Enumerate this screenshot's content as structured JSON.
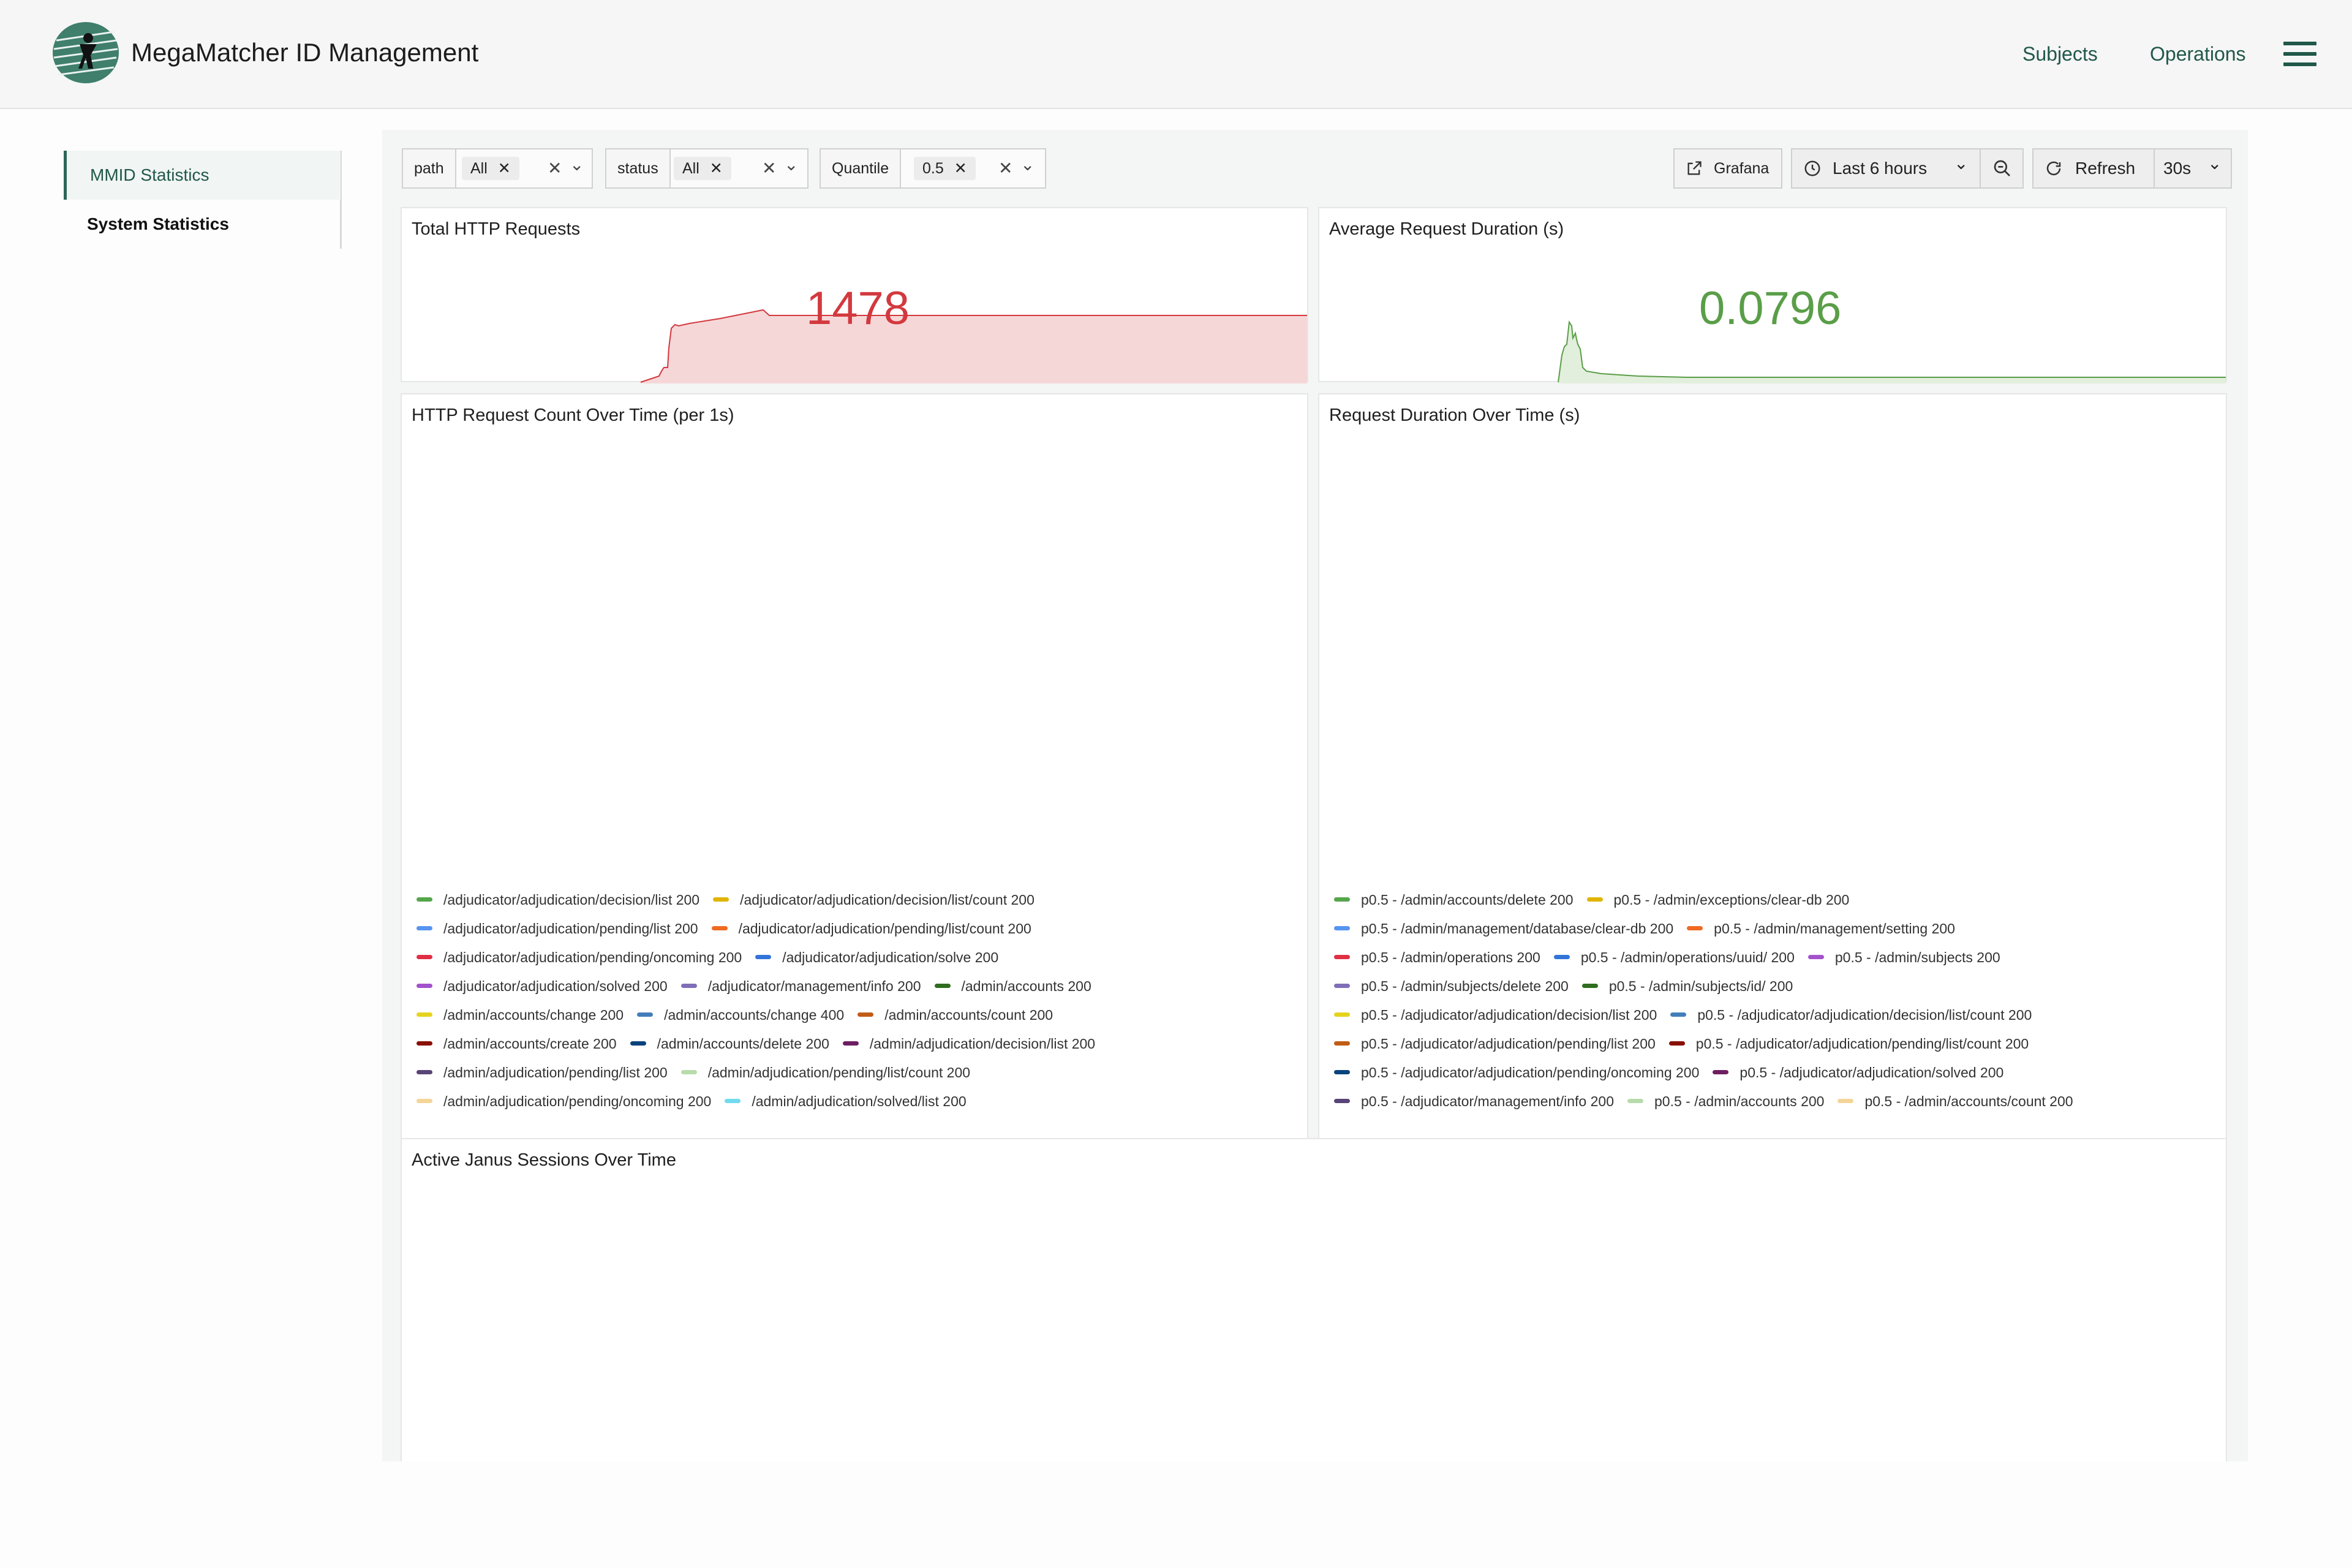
{
  "app": {
    "title": "MegaMatcher ID Management"
  },
  "nav": {
    "subjects": "Subjects",
    "operations": "Operations",
    "menu_icon": "hamburger-menu-icon"
  },
  "sidebar": {
    "items": [
      {
        "label": "MMID Statistics",
        "active": true
      },
      {
        "label": "System Statistics",
        "active": false
      }
    ]
  },
  "filters": {
    "path": {
      "label": "path",
      "value": "All"
    },
    "status": {
      "label": "status",
      "value": "All"
    },
    "quantile": {
      "label": "Quantile",
      "value": "0.5"
    },
    "clear_symbol": "✕",
    "chevron_symbol": "⌄"
  },
  "toolbar": {
    "grafana": "Grafana",
    "time_range": "Last 6 hours",
    "refresh": "Refresh",
    "interval": "30s"
  },
  "panels": {
    "total_requests": {
      "title": "Total HTTP Requests",
      "value": "1478",
      "color": "#d2393e",
      "fill": "#f6d7d8"
    },
    "avg_duration": {
      "title": "Average Request Duration (s)",
      "value": "0.0796",
      "color": "#5a9e48",
      "fill": "#e2efdc"
    },
    "request_count": {
      "title": "HTTP Request Count Over Time (per 1s)"
    },
    "request_duration": {
      "title": "Request Duration Over Time (s)"
    },
    "janus_sessions": {
      "title": "Active Janus Sessions Over Time"
    }
  },
  "legend_count": [
    [
      {
        "label": "/adjudicator/adjudication/decision/list 200",
        "color": "#56a64b"
      },
      {
        "label": "/adjudicator/adjudication/decision/list/count 200",
        "color": "#e0b400"
      }
    ],
    [
      {
        "label": "/adjudicator/adjudication/pending/list 200",
        "color": "#5794f2"
      },
      {
        "label": "/adjudicator/adjudication/pending/list/count 200",
        "color": "#ee6b23"
      }
    ],
    [
      {
        "label": "/adjudicator/adjudication/pending/oncoming 200",
        "color": "#e02f44"
      },
      {
        "label": "/adjudicator/adjudication/solve 200",
        "color": "#3274d9"
      }
    ],
    [
      {
        "label": "/adjudicator/adjudication/solved 200",
        "color": "#a352cc"
      },
      {
        "label": "/adjudicator/management/info 200",
        "color": "#806eb7"
      },
      {
        "label": "/admin/accounts 200",
        "color": "#2f6c1f"
      }
    ],
    [
      {
        "label": "/admin/accounts/change 200",
        "color": "#e5d320"
      },
      {
        "label": "/admin/accounts/change 400",
        "color": "#447ebc"
      },
      {
        "label": "/admin/accounts/count 200",
        "color": "#c15c17"
      }
    ],
    [
      {
        "label": "/admin/accounts/create 200",
        "color": "#890f02"
      },
      {
        "label": "/admin/accounts/delete 200",
        "color": "#0a437c"
      },
      {
        "label": "/admin/adjudication/decision/list 200",
        "color": "#6d1f62"
      }
    ],
    [
      {
        "label": "/admin/adjudication/pending/list 200",
        "color": "#584477"
      },
      {
        "label": "/admin/adjudication/pending/list/count 200",
        "color": "#b7dbab"
      }
    ],
    [
      {
        "label": "/admin/adjudication/pending/oncoming 200",
        "color": "#f4d598"
      },
      {
        "label": "/admin/adjudication/solved/list 200",
        "color": "#70dbed"
      }
    ]
  ],
  "legend_duration": [
    [
      {
        "label": "p0.5 - /admin/accounts/delete 200",
        "color": "#56a64b"
      },
      {
        "label": "p0.5 - /admin/exceptions/clear-db 200",
        "color": "#e0b400"
      }
    ],
    [
      {
        "label": "p0.5 - /admin/management/database/clear-db 200",
        "color": "#5794f2"
      },
      {
        "label": "p0.5 - /admin/management/setting 200",
        "color": "#ee6b23"
      }
    ],
    [
      {
        "label": "p0.5 - /admin/operations 200",
        "color": "#e02f44"
      },
      {
        "label": "p0.5 - /admin/operations/uuid/ 200",
        "color": "#3274d9"
      },
      {
        "label": "p0.5 - /admin/subjects 200",
        "color": "#a352cc"
      }
    ],
    [
      {
        "label": "p0.5 - /admin/subjects/delete 200",
        "color": "#806eb7"
      },
      {
        "label": "p0.5 - /admin/subjects/id/ 200",
        "color": "#2f6c1f"
      }
    ],
    [
      {
        "label": "p0.5 - /adjudicator/adjudication/decision/list 200",
        "color": "#e5d320"
      },
      {
        "label": "p0.5 - /adjudicator/adjudication/decision/list/count 200",
        "color": "#447ebc"
      }
    ],
    [
      {
        "label": "p0.5 - /adjudicator/adjudication/pending/list 200",
        "color": "#c15c17"
      },
      {
        "label": "p0.5 - /adjudicator/adjudication/pending/list/count 200",
        "color": "#890f02"
      }
    ],
    [
      {
        "label": "p0.5 - /adjudicator/adjudication/pending/oncoming 200",
        "color": "#0a437c"
      },
      {
        "label": "p0.5 - /adjudicator/adjudication/solved 200",
        "color": "#6d1f62"
      }
    ],
    [
      {
        "label": "p0.5 - /adjudicator/management/info 200",
        "color": "#584477"
      },
      {
        "label": "p0.5 - /admin/accounts 200",
        "color": "#b7dbab"
      },
      {
        "label": "p0.5 - /admin/accounts/count 200",
        "color": "#f4d598"
      }
    ]
  ]
}
